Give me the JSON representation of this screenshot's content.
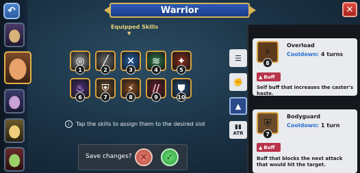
{
  "window": {
    "title": "Warrior",
    "close_icon": "close-icon",
    "back_icon": "back-arrow-icon"
  },
  "skills_header": {
    "label": "Equipped Skills"
  },
  "skill_slots": [
    {
      "number": "1",
      "icon": "whirlwind-icon",
      "color": "#8e8e8e"
    },
    {
      "number": "2",
      "icon": "slash-icon",
      "color": "#6a6a6a"
    },
    {
      "number": "3",
      "icon": "cross-blades-icon",
      "color": "#1f5fa8"
    },
    {
      "number": "4",
      "icon": "green-wind-icon",
      "color": "#2b7a4a"
    },
    {
      "number": "5",
      "icon": "fire-strike-icon",
      "color": "#8a2a1a"
    },
    {
      "number": "6",
      "icon": "purple-flame-icon",
      "color": "#4b2a7a"
    },
    {
      "number": "7",
      "icon": "bodyguard-icon",
      "color": "#6a4a2a"
    },
    {
      "number": "8",
      "icon": "overload-icon",
      "color": "#8a4a1a"
    },
    {
      "number": "9",
      "icon": "claw-icon",
      "color": "#6a1a2a"
    },
    {
      "number": "10",
      "icon": "armor-icon",
      "color": "#1e4a7a"
    }
  ],
  "hint": {
    "text": "Tap the skills to assign them to the desired slot",
    "icon": "info-icon"
  },
  "save_dialog": {
    "label": "Save changes?",
    "cancel_icon": "cross-icon",
    "confirm_icon": "checkmark-icon"
  },
  "side_tabs": [
    {
      "icon": "list-icon",
      "label": ""
    },
    {
      "icon": "fist-icon",
      "label": ""
    },
    {
      "icon": "flame-icon",
      "label": ""
    },
    {
      "icon": "stats-icon",
      "label": "ATR"
    }
  ],
  "skill_cards": [
    {
      "title": "Overload",
      "cooldown_label": "Cooldown:",
      "cooldown_value": "4 turns",
      "slot": "8",
      "tag": "Buff",
      "description": "Self buff that increases the caster's haste."
    },
    {
      "title": "Bodyguard",
      "cooldown_label": "Cooldown:",
      "cooldown_value": "1 turn",
      "slot": "7",
      "tag": "Buff",
      "description": "Buff that blocks the next attack that would hit the target."
    }
  ],
  "colors": {
    "accent_gold": "#d9a23f",
    "banner_blue": "#2c5bb6",
    "buff_red": "#b8344b",
    "cooldown_blue": "#2c6fd1"
  }
}
